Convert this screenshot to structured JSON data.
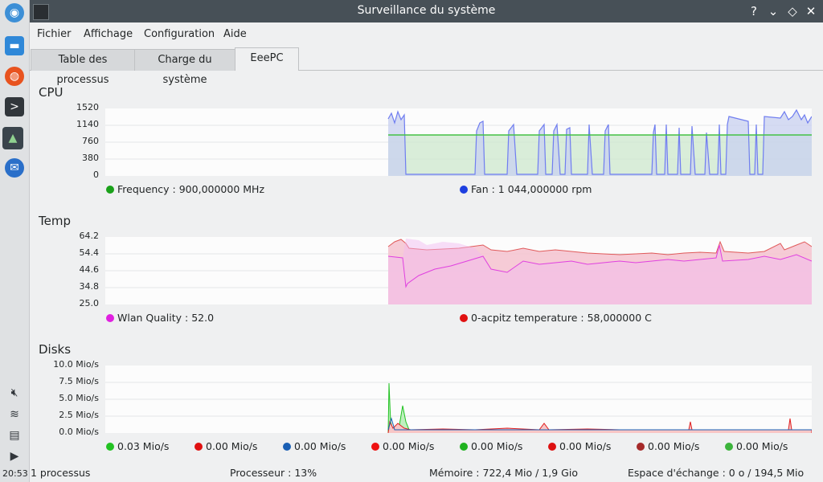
{
  "window": {
    "title": "Surveillance du système"
  },
  "menu": [
    "Fichier",
    "Affichage",
    "Configuration",
    "Aide"
  ],
  "tabs": [
    "Table des processus",
    "Charge du système",
    "EeePC"
  ],
  "clock": "20:53",
  "sections": {
    "cpu": {
      "title": "CPU",
      "yticks": [
        "1520",
        "1140",
        "760",
        "380",
        "0"
      ],
      "legend": [
        {
          "text": "Frequency : 900,000000 MHz",
          "color": "#1aa11a"
        },
        {
          "text": "Fan : 1 044,000000 rpm",
          "color": "#1d3fe0"
        }
      ]
    },
    "temp": {
      "title": "Temp",
      "yticks": [
        "64.2",
        "54.4",
        "44.6",
        "34.8",
        "25.0"
      ],
      "legend": [
        {
          "text": "Wlan Quality : 52.0",
          "color": "#e020e0"
        },
        {
          "text": "0-acpitz temperature : 58,000000 C",
          "color": "#e01010"
        }
      ]
    },
    "disks": {
      "title": "Disks",
      "yticks": [
        "10.0 Mio/s",
        "7.5 Mio/s",
        "5.0 Mio/s",
        "2.5 Mio/s",
        "0.0 Mio/s"
      ],
      "legend": [
        {
          "text": "0.03 Mio/s",
          "color": "#22c222"
        },
        {
          "text": "0.00 Mio/s",
          "color": "#e01010"
        },
        {
          "text": "0.00 Mio/s",
          "color": "#1a5fb4"
        },
        {
          "text": "0.00 Mio/s",
          "color": "#ee1111"
        },
        {
          "text": "0.00 Mio/s",
          "color": "#1fb21f"
        },
        {
          "text": "0.00 Mio/s",
          "color": "#dd1111"
        },
        {
          "text": "0.00 Mio/s",
          "color": "#a52a2a"
        },
        {
          "text": "0.00 Mio/s",
          "color": "#3cb43c"
        }
      ]
    }
  },
  "status": {
    "processes": "1 processus",
    "cpu": "Processeur : 13%",
    "memory": "Mémoire : 722,4 Mio / 1,9 Gio",
    "swap": "Espace d'échange : 0 o / 194,5 Mio"
  }
}
